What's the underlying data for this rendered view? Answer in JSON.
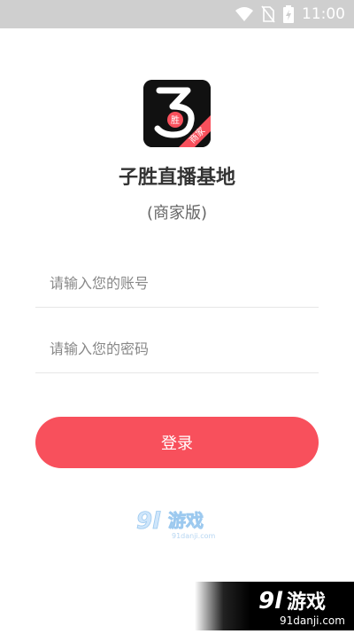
{
  "status_bar": {
    "time": "11:00",
    "icons": [
      "wifi-icon",
      "no-sim-icon",
      "battery-charging-icon"
    ],
    "background": "#cfcfcf"
  },
  "logo": {
    "badge_char": "胜",
    "ribbon_text": "商家"
  },
  "app": {
    "title": "子胜直播基地",
    "subtitle": "(商家版)"
  },
  "form": {
    "account_placeholder": "请输入您的账号",
    "password_placeholder": "请输入您的密码",
    "login_label": "登录",
    "accent": "#f8505c"
  },
  "watermark": {
    "logo_text": "9l游戏",
    "domain": "91danji.com"
  }
}
